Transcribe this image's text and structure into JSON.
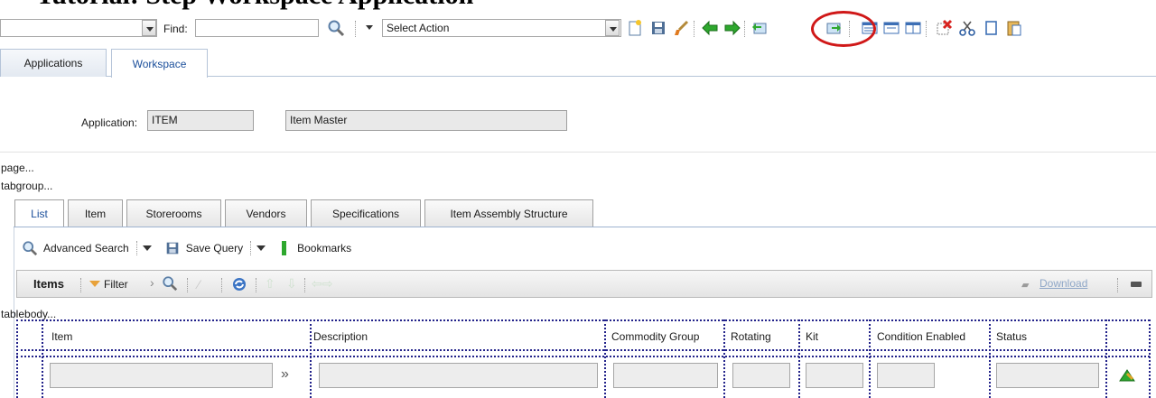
{
  "heading_fragment": "Tutorial: Step Workspace Application",
  "toolbar": {
    "find_label": "Find:",
    "find_value": "",
    "left_combo_value": "",
    "select_action": "Select Action",
    "icons": [
      "search-icon",
      "new-record-icon",
      "save-icon",
      "clear-icon",
      "previous-record-icon",
      "next-record-icon",
      "previous-screen-icon",
      "return-icon",
      "view-list-icon",
      "view-details-icon",
      "view-split-icon",
      "delete-icon",
      "cut-icon",
      "copy-icon",
      "paste-icon"
    ],
    "highlight_color": "#d01818"
  },
  "app_tabs": [
    {
      "label": "Applications",
      "active": false
    },
    {
      "label": "Workspace",
      "active": true
    }
  ],
  "application": {
    "label": "Application:",
    "code": "ITEM",
    "name": "Item Master"
  },
  "debug": {
    "page": "page...",
    "tabgroup": "tabgroup...",
    "tablebody": "tablebody..."
  },
  "inner_tabs": [
    {
      "label": "List",
      "active": true
    },
    {
      "label": "Item",
      "active": false
    },
    {
      "label": "Storerooms",
      "active": false
    },
    {
      "label": "Vendors",
      "active": false
    },
    {
      "label": "Specifications",
      "active": false
    },
    {
      "label": "Item Assembly Structure",
      "active": false
    }
  ],
  "list_toolbar": {
    "advanced_search": "Advanced Search",
    "save_query": "Save Query",
    "bookmarks": "Bookmarks"
  },
  "items_table": {
    "title": "Items",
    "filter": "Filter",
    "download": "Download",
    "columns": [
      "Item",
      "Description",
      "Commodity Group",
      "Rotating",
      "Kit",
      "Condition Enabled",
      "Status"
    ]
  }
}
